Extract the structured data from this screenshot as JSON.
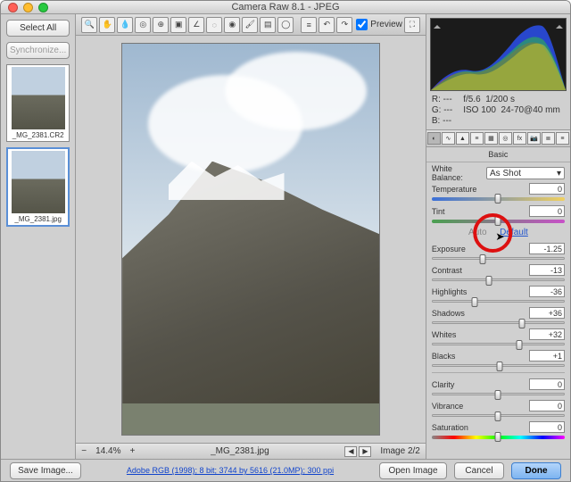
{
  "window": {
    "title": "Camera Raw 8.1  -  JPEG"
  },
  "filmstrip": {
    "select_all": "Select All",
    "synchronize": "Synchronize...",
    "thumbs": [
      {
        "label": "_MG_2381.CR2"
      },
      {
        "label": "_MG_2381.jpg"
      }
    ]
  },
  "toolbar": {
    "preview_label": "Preview",
    "preview_checked": true
  },
  "status": {
    "zoom": "14.4%",
    "filename": "_MG_2381.jpg",
    "image_counter": "Image 2/2"
  },
  "histogram": {
    "rgb": {
      "R": "---",
      "G": "---",
      "B": "---"
    },
    "exif": {
      "aperture": "f/5.6",
      "shutter": "1/200 s",
      "iso": "ISO 100",
      "lens": "24-70@40 mm"
    }
  },
  "panel": {
    "title": "Basic",
    "white_balance_label": "White Balance:",
    "white_balance_value": "As Shot",
    "auto": "Auto",
    "default": "Default",
    "sliders": {
      "temperature": {
        "label": "Temperature",
        "value": "0",
        "pos": 50
      },
      "tint": {
        "label": "Tint",
        "value": "0",
        "pos": 50
      },
      "exposure": {
        "label": "Exposure",
        "value": "-1.25",
        "pos": 38
      },
      "contrast": {
        "label": "Contrast",
        "value": "-13",
        "pos": 43
      },
      "highlights": {
        "label": "Highlights",
        "value": "-36",
        "pos": 32
      },
      "shadows": {
        "label": "Shadows",
        "value": "+36",
        "pos": 68
      },
      "whites": {
        "label": "Whites",
        "value": "+32",
        "pos": 66
      },
      "blacks": {
        "label": "Blacks",
        "value": "+1",
        "pos": 51
      },
      "clarity": {
        "label": "Clarity",
        "value": "0",
        "pos": 50
      },
      "vibrance": {
        "label": "Vibrance",
        "value": "0",
        "pos": 50
      },
      "saturation": {
        "label": "Saturation",
        "value": "0",
        "pos": 50
      }
    }
  },
  "footer": {
    "save_image": "Save Image...",
    "profile_link": "Adobe RGB (1998); 8 bit; 3744 by 5616 (21.0MP); 300 ppi",
    "open_image": "Open Image",
    "cancel": "Cancel",
    "done": "Done"
  }
}
